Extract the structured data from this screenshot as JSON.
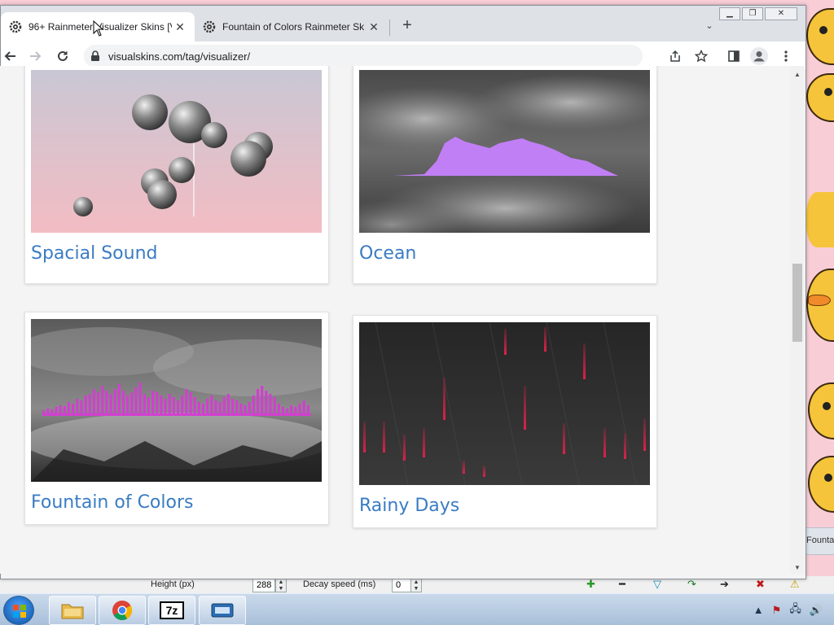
{
  "browser": {
    "tabs": [
      {
        "title": "96+ Rainmeter Visualizer Skins [V",
        "active": true
      },
      {
        "title": "Fountain of Colors Rainmeter Sk",
        "active": false
      }
    ],
    "address": {
      "url": "visualskins.com/tag/visualizer/"
    }
  },
  "cards": [
    {
      "name": "Spacial Sound"
    },
    {
      "name": "Ocean"
    },
    {
      "name": "Fountain of Colors"
    },
    {
      "name": "Rainy Days"
    }
  ],
  "background_app": {
    "height_label": "Height (px)",
    "height_value": "288",
    "decay_label": "Decay speed (ms)",
    "decay_value": "0",
    "side_window_title": "Founta"
  },
  "icons": {
    "tab_favicon": "gear-icon",
    "back": "back-arrow-icon",
    "forward": "forward-arrow-icon",
    "reload": "reload-icon",
    "lock": "lock-icon",
    "share": "share-icon",
    "bookmark": "star-icon",
    "side_panel": "side-panel-icon",
    "profile": "profile-icon",
    "menu": "kebab-menu-icon"
  },
  "colors": {
    "link_blue": "#3a7cc3",
    "ocean_wave": "#c17ff5",
    "fountain_bars": "#d23fd0",
    "rain_red": "#e0204a"
  }
}
